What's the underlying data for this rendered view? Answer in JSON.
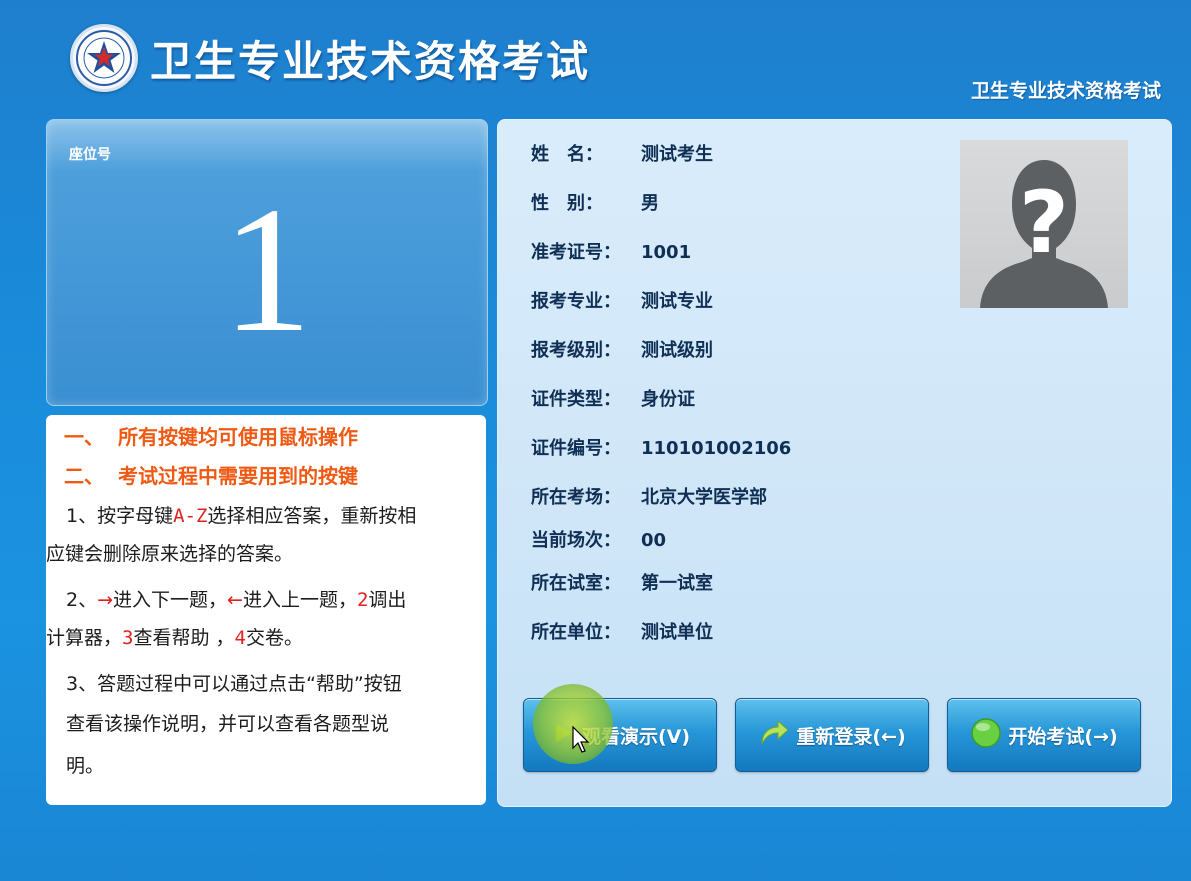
{
  "header": {
    "title": "卫生专业技术资格考试",
    "subtitle": "卫生专业技术资格考试"
  },
  "seat": {
    "label": "座位号",
    "number": "1"
  },
  "instructions": {
    "heading1_num": "一、",
    "heading1_text": "所有按键均可使用鼠标操作",
    "heading2_num": "二、",
    "heading2_text": "考试过程中需要用到的按键",
    "item1_a": "1、按字母键",
    "item1_keys": "A-Z",
    "item1_b": "选择相应答案，重新按相",
    "item1_c": "应键会删除原来选择的答案。",
    "item2_a": "2、",
    "item2_arrow_right": "→",
    "item2_b": "进入下一题，",
    "item2_arrow_left": "←",
    "item2_c": "进入上一题，",
    "item2_key2": "2",
    "item2_d": "调出",
    "item2_e": "计算器，",
    "item2_key3": "3",
    "item2_f": "查看帮助 ，",
    "item2_key4": "4",
    "item2_g": "交卷。",
    "item3_a": "3、答题过程中可以通过点击“帮助”按钮",
    "item3_b": "查看该操作说明，并可以查看各题型说",
    "item3_c": "明。"
  },
  "candidate": {
    "name_label": "姓　名：",
    "name": "测试考生",
    "gender_label": "性　别：",
    "gender": "男",
    "ticket_label": "准考证号：",
    "ticket": "1001",
    "major_label": "报考专业：",
    "major": "测试专业",
    "level_label": "报考级别：",
    "level": "测试级别",
    "id_type_label": "证件类型：",
    "id_type": "身份证",
    "id_number_label": "证件编号：",
    "id_number": "110101002106",
    "site_label": "所在考场：",
    "site": "北京大学医学部",
    "session_label": "当前场次：",
    "session": "00",
    "room_label": "所在试室：",
    "room": "第一试室",
    "unit_label": "所在单位：",
    "unit": "测试单位"
  },
  "buttons": {
    "demo": "观看演示(V)",
    "relogin": "重新登录(←)",
    "start": "开始考试(→)"
  },
  "icons": {
    "logo": "exam-emblem-icon",
    "photo": "avatar-placeholder-icon",
    "relogin": "curved-arrow-icon",
    "start": "green-circle-icon"
  },
  "colors": {
    "background": "#1a8ad9",
    "heading_orange": "#ee5a14",
    "key_red": "#e32020"
  }
}
